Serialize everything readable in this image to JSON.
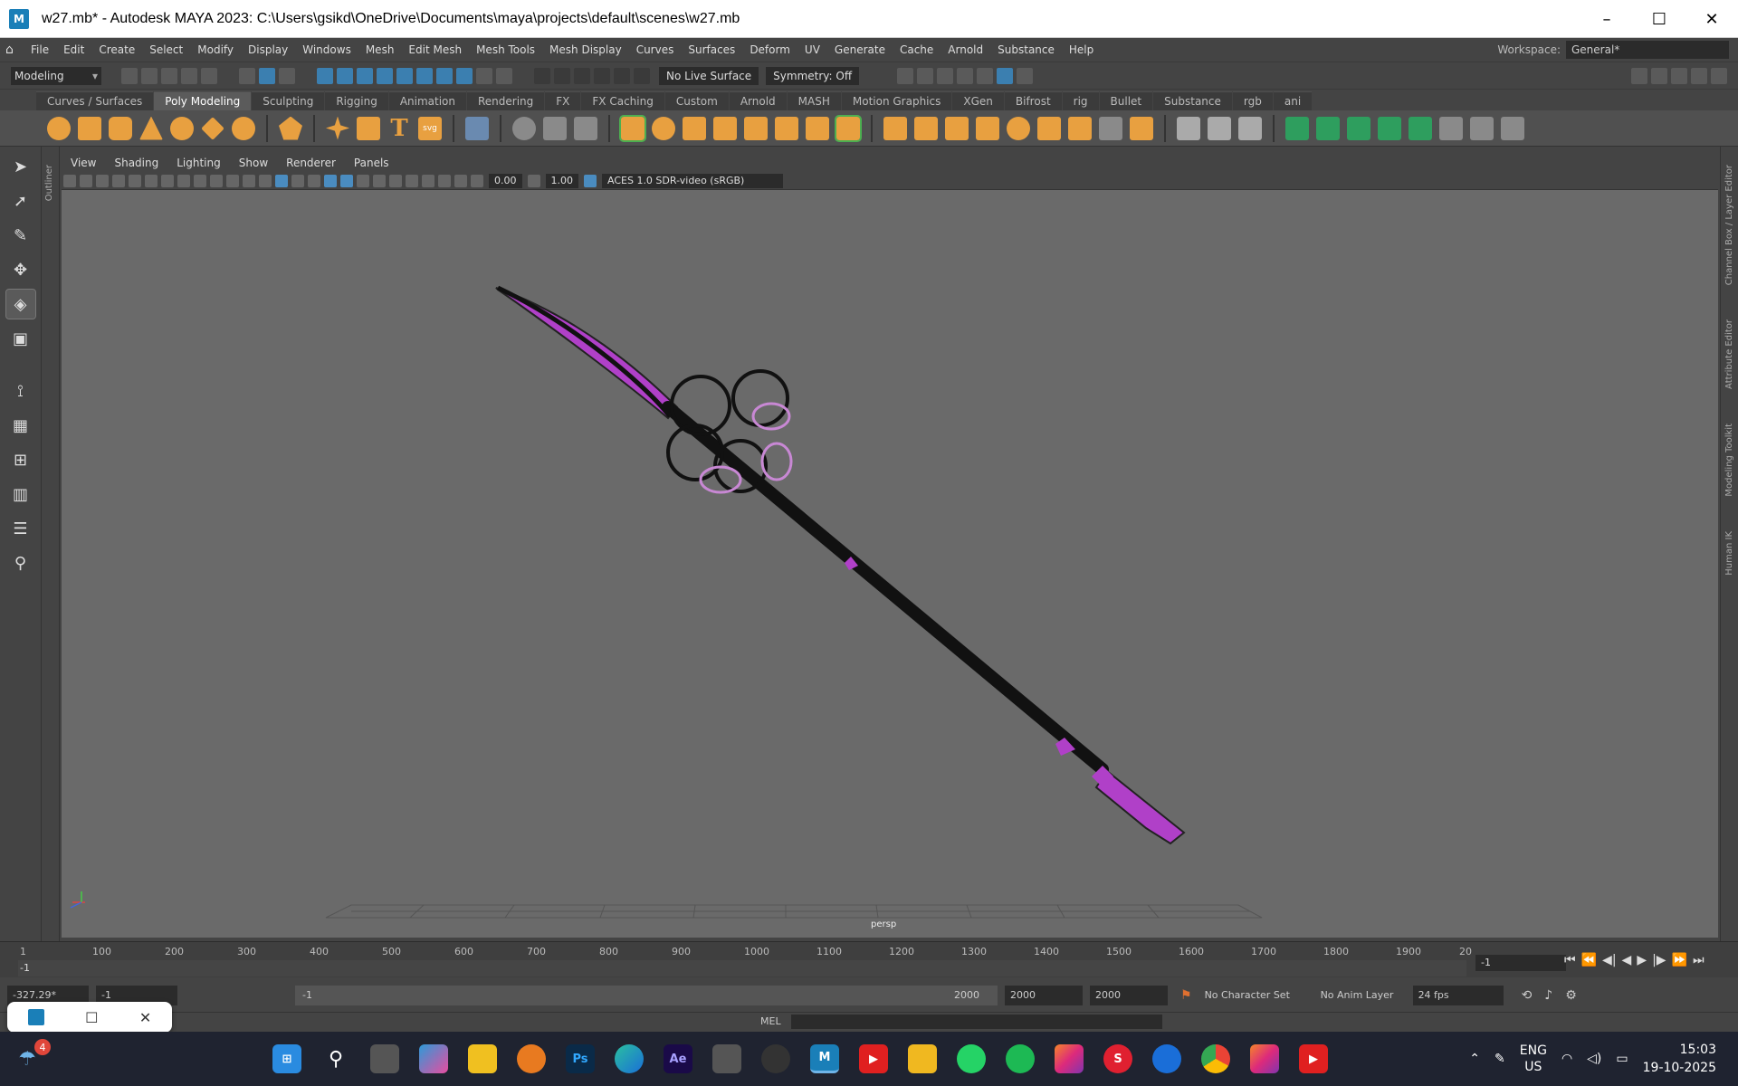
{
  "window": {
    "title": "w27.mb* - Autodesk MAYA 2023: C:\\Users\\gsikd\\OneDrive\\Documents\\maya\\projects\\default\\scenes\\w27.mb",
    "logo": "M"
  },
  "menu": [
    "File",
    "Edit",
    "Create",
    "Select",
    "Modify",
    "Display",
    "Windows",
    "Mesh",
    "Edit Mesh",
    "Mesh Tools",
    "Mesh Display",
    "Curves",
    "Surfaces",
    "Deform",
    "UV",
    "Generate",
    "Cache",
    "Arnold",
    "Substance",
    "Help"
  ],
  "workspace": {
    "label": "Workspace:",
    "value": "General*"
  },
  "status": {
    "mode": "Modeling",
    "live_surface": "No Live Surface",
    "symmetry": "Symmetry: Off"
  },
  "shelf_tabs": [
    "Curves / Surfaces",
    "Poly Modeling",
    "Sculpting",
    "Rigging",
    "Animation",
    "Rendering",
    "FX",
    "FX Caching",
    "Custom",
    "Arnold",
    "MASH",
    "Motion Graphics",
    "XGen",
    "Bifrost",
    "rig",
    "Bullet",
    "Substance",
    "rgb",
    "ani"
  ],
  "shelf_active": "Poly Modeling",
  "panel_menu": [
    "View",
    "Shading",
    "Lighting",
    "Show",
    "Renderer",
    "Panels"
  ],
  "panel_values": {
    "exposure": "0.00",
    "gamma": "1.00",
    "colorspace": "ACES 1.0 SDR-video (sRGB)"
  },
  "viewport": {
    "camera": "persp"
  },
  "side_labels": {
    "outliner": "Outliner",
    "right": [
      "Channel Box / Layer Editor",
      "Attribute Editor",
      "Modeling Toolkit",
      "Human IK"
    ]
  },
  "timeline": {
    "ticks": [
      "1",
      "100",
      "200",
      "300",
      "400",
      "500",
      "600",
      "700",
      "800",
      "900",
      "1000",
      "1100",
      "1200",
      "1300",
      "1400",
      "1500",
      "1600",
      "1700",
      "1800",
      "1900",
      "20"
    ],
    "current": "-1",
    "current_frame_field": "-1"
  },
  "range": {
    "coord": "-327.29*",
    "start": "-1",
    "slider_start": "-1",
    "slider_end": "2000",
    "end1": "2000",
    "end2": "2000",
    "character_set": "No Character Set",
    "anim_layer": "No Anim Layer",
    "fps": "24 fps"
  },
  "cmd": {
    "label": "MEL"
  },
  "taskbar": {
    "badge": "4",
    "lang1": "ENG",
    "lang2": "US",
    "time": "15:03",
    "date": "19-10-2025"
  },
  "colors": {
    "accent": "#b040c8",
    "maya_blue": "#1a7fb8"
  }
}
